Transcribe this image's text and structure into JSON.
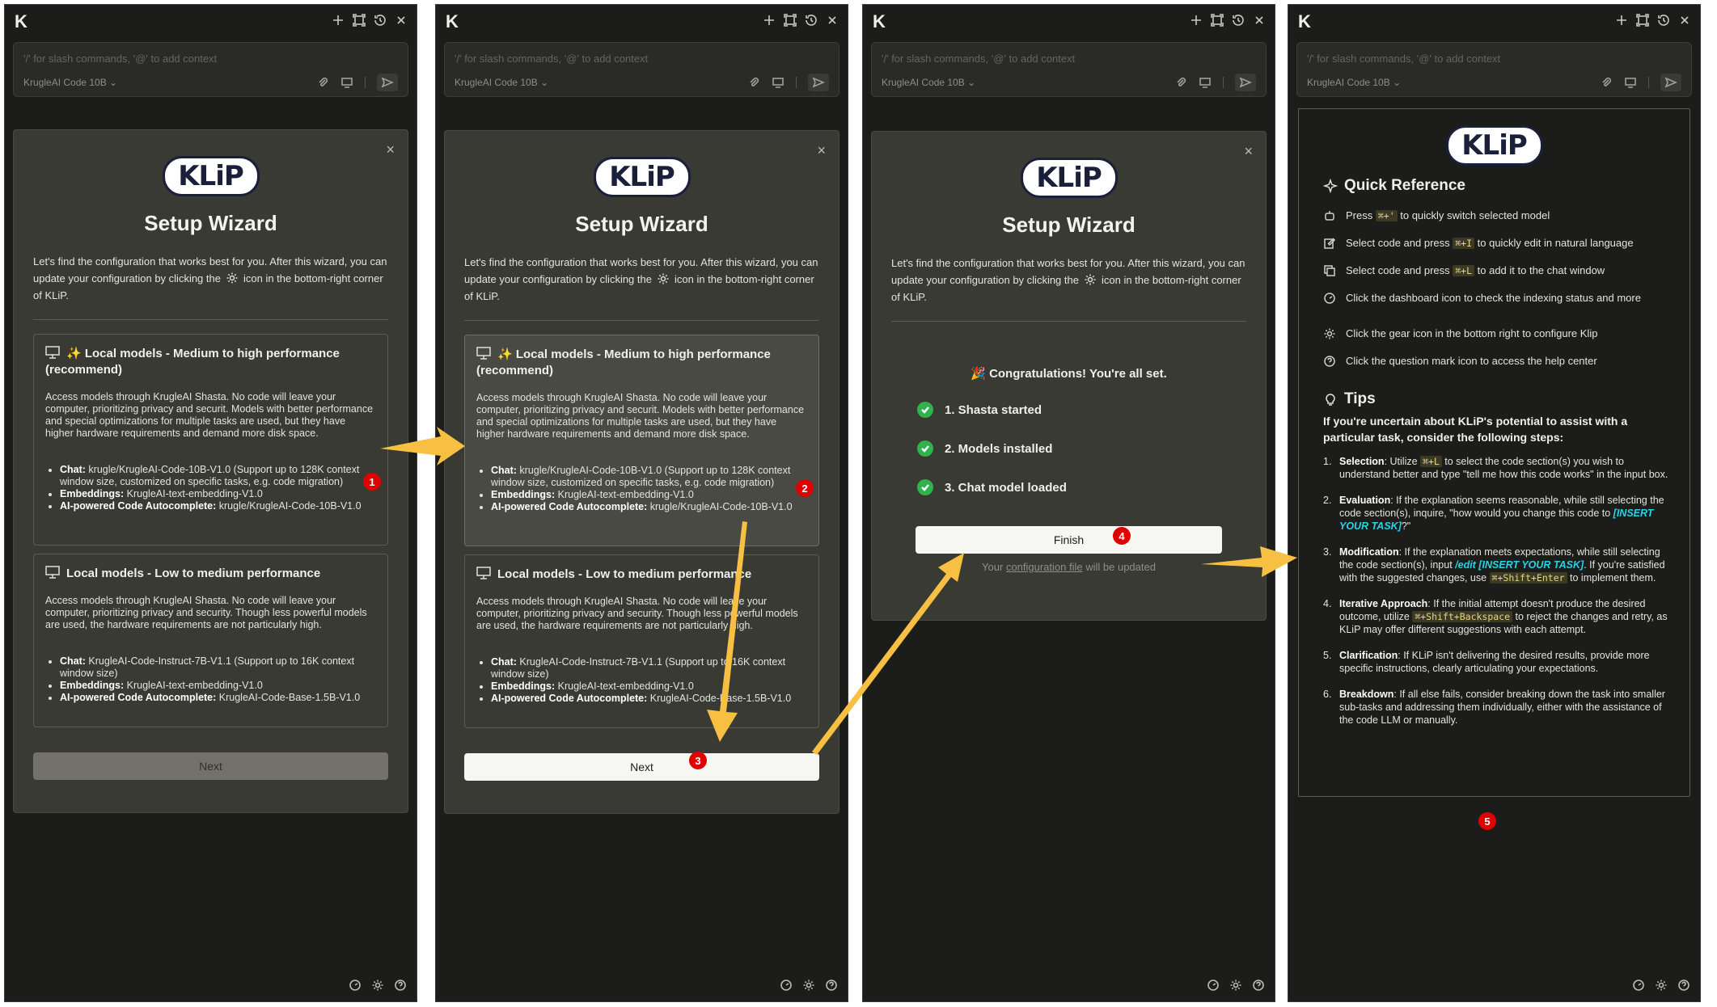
{
  "app": {
    "logo": "K",
    "input_placeholder": "'/' for slash commands, '@' to add context",
    "model_selector": "KrugleAI Code 10B ⌄"
  },
  "wizard": {
    "logo_text": "KLiP",
    "title": "Setup Wizard",
    "intro_before_icon": "Let's find the configuration that works best for you. After this wizard, you can update your configuration by clicking the",
    "intro_after_icon": "icon in the bottom-right corner of KLiP.",
    "close": "×"
  },
  "cards": [
    {
      "title": "✨ Local models - Medium to high performance (recommend)",
      "description": "Access models through KrugleAI Shasta. No code will leave your computer, prioritizing privacy and securit. Models with better performance and special optimizations for multiple tasks are used, but they have higher hardware requirements and demand more disk space.",
      "bullets": [
        {
          "label": "Chat:",
          "text": " krugle/KrugleAI-Code-10B-V1.0 (Support up to 128K context window size, customized on specific tasks, e.g. code migration)"
        },
        {
          "label": "Embeddings:",
          "text": " KrugleAI-text-embedding-V1.0"
        },
        {
          "label": "AI-powered Code Autocomplete:",
          "text": " krugle/KrugleAI-Code-10B-V1.0"
        }
      ]
    },
    {
      "title": "Local models - Low to medium performance",
      "description": "Access models through KrugleAI Shasta. No code will leave your computer, prioritizing privacy and security. Though less powerful models are used, the hardware requirements are not particularly high.",
      "bullets": [
        {
          "label": "Chat:",
          "text": " KrugleAI-Code-Instruct-7B-V1.1 (Support up to 16K context window size)"
        },
        {
          "label": "Embeddings:",
          "text": " KrugleAI-text-embedding-V1.0"
        },
        {
          "label": "AI-powered Code Autocomplete:",
          "text": " KrugleAI-Code-Base-1.5B-V1.0"
        }
      ]
    }
  ],
  "buttons": {
    "next": "Next",
    "finish": "Finish"
  },
  "finish": {
    "congrats": "🎉 Congratulations! You're all set.",
    "steps": [
      "1. Shasta started",
      "2. Models installed",
      "3. Chat model loaded"
    ],
    "update_before": "Your ",
    "update_link": "configuration file",
    "update_after": " will be updated"
  },
  "quickref": {
    "title": "Quick Reference",
    "items": [
      {
        "pre": "Press ",
        "kbd": "⌘+'",
        "post": " to quickly switch selected model",
        "icon": "robot-icon"
      },
      {
        "pre": "Select code and press ",
        "kbd": "⌘+I",
        "post": " to quickly edit in natural language",
        "icon": "edit-icon"
      },
      {
        "pre": "Select code and press ",
        "kbd": "⌘+L",
        "post": " to add it to the chat window",
        "icon": "copy-icon"
      },
      {
        "pre": "Click the dashboard icon to check the indexing status and more",
        "kbd": "",
        "post": "",
        "icon": "dashboard-icon"
      },
      {
        "pre": "Click the gear icon in the bottom right to configure Klip",
        "kbd": "",
        "post": "",
        "icon": "gear-icon"
      },
      {
        "pre": "Click the question mark icon to access the help center",
        "kbd": "",
        "post": "",
        "icon": "help-icon"
      }
    ],
    "tips_title": "Tips",
    "tips_intro": "If you're uncertain about KLiP's potential to assist with a particular task, consider the following steps:",
    "tips": {
      "t1_label": "Selection",
      "t1_a": ": Utilize ",
      "t1_kbd": "⌘+L",
      "t1_b": " to select the code section(s) you wish to understand better and type \"tell me how this code works\" in the input box.",
      "t2_label": "Evaluation",
      "t2_a": ": If the explanation seems reasonable, while still selecting the code section(s), inquire, \"how would you change this code to ",
      "t2_cyan": "[INSERT YOUR TASK]",
      "t2_b": "?\"",
      "t3_label": "Modification",
      "t3_a": ": If the explanation meets expectations, while still selecting the code section(s), input ",
      "t3_cyan": "/edit [INSERT YOUR TASK]",
      "t3_b": ". If you're satisfied with the suggested changes, use ",
      "t3_kbd": "⌘+Shift+Enter",
      "t3_c": " to implement them.",
      "t4_label": "Iterative Approach",
      "t4_a": ": If the initial attempt doesn't produce the desired outcome, utilize ",
      "t4_kbd": "⌘+Shift+Backspace",
      "t4_b": " to reject the changes and retry, as KLiP may offer different suggestions with each attempt.",
      "t5_label": "Clarification",
      "t5_a": ": If KLiP isn't delivering the desired results, provide more specific instructions, clearly articulating your expectations.",
      "t6_label": "Breakdown",
      "t6_a": ": If all else fails, consider breaking down the task into smaller sub-tasks and addressing them individually, either with the assistance of the code LLM or manually."
    }
  },
  "badges": [
    "1",
    "2",
    "3",
    "4",
    "5"
  ],
  "colors": {
    "arrow": "#f7c042",
    "badge": "#e00000",
    "check": "#2fb34c",
    "accent_cyan": "#27d3e6"
  },
  "numbers": {
    "t1": "1.",
    "t2": "2.",
    "t3": "3.",
    "t4": "4.",
    "t5": "5.",
    "t6": "6."
  }
}
